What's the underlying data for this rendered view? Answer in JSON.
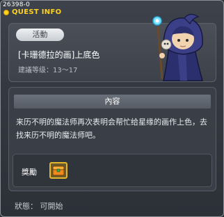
{
  "window": {
    "id_label": "26398-0",
    "title": "QUEST INFO"
  },
  "quest": {
    "tag": "活動",
    "name": "[卡珊德拉的画]上底色",
    "level_text": "建議等级：13～17",
    "npc_icon": "dark-wizard-npc-icon"
  },
  "content": {
    "header": "內容",
    "description": "来历不明的魔法师再次表明会帮忙给星缘的画作上色，去找来历不明的魔法师吧。"
  },
  "reward": {
    "label": "獎勵",
    "item_icon": "orange-treasure-box-icon"
  },
  "status": {
    "text": "狀態： 可開始"
  },
  "colors": {
    "title": "#ffd21e",
    "reward_border": "#e6b62a"
  }
}
